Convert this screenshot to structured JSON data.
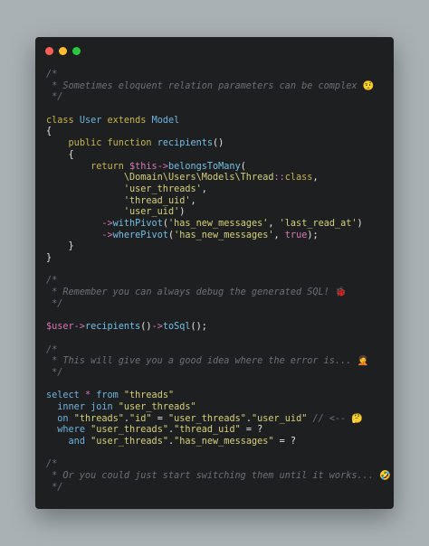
{
  "window": {
    "controls": [
      "close",
      "minimize",
      "maximize"
    ],
    "colors": {
      "close": "#ff5f57",
      "minimize": "#febc2e",
      "maximize": "#28c840"
    }
  },
  "code": {
    "lines": [
      [
        [
          "c",
          "/*"
        ]
      ],
      [
        [
          "c",
          " * Sometimes eloquent relation parameters can be complex "
        ],
        [
          "c",
          "🤨"
        ]
      ],
      [
        [
          "c",
          " */"
        ]
      ],
      [],
      [
        [
          "k",
          "class "
        ],
        [
          "t",
          "User "
        ],
        [
          "k",
          "extends "
        ],
        [
          "t",
          "Model"
        ]
      ],
      [
        [
          "p",
          "{"
        ]
      ],
      [
        [
          "p",
          "    "
        ],
        [
          "k",
          "public function "
        ],
        [
          "f",
          "recipients"
        ],
        [
          "p",
          "()"
        ]
      ],
      [
        [
          "p",
          "    {"
        ]
      ],
      [
        [
          "p",
          "        "
        ],
        [
          "k",
          "return "
        ],
        [
          "v",
          "$this"
        ],
        [
          "o",
          "->"
        ],
        [
          "f",
          "belongsToMany"
        ],
        [
          "p",
          "("
        ]
      ],
      [
        [
          "p",
          "              "
        ],
        [
          "s",
          "\\Domain\\Users\\Models\\Thread"
        ],
        [
          "o",
          "::"
        ],
        [
          "k",
          "class"
        ],
        [
          "p",
          ","
        ]
      ],
      [
        [
          "p",
          "              "
        ],
        [
          "s",
          "'user_threads'"
        ],
        [
          "p",
          ","
        ]
      ],
      [
        [
          "p",
          "              "
        ],
        [
          "s",
          "'thread_uid'"
        ],
        [
          "p",
          ","
        ]
      ],
      [
        [
          "p",
          "              "
        ],
        [
          "s",
          "'user_uid'"
        ],
        [
          "p",
          ")"
        ]
      ],
      [
        [
          "p",
          "          "
        ],
        [
          "o",
          "->"
        ],
        [
          "f",
          "withPivot"
        ],
        [
          "p",
          "("
        ],
        [
          "s",
          "'has_new_messages'"
        ],
        [
          "p",
          ", "
        ],
        [
          "s",
          "'last_read_at'"
        ],
        [
          "p",
          ")"
        ]
      ],
      [
        [
          "p",
          "          "
        ],
        [
          "o",
          "->"
        ],
        [
          "f",
          "wherePivot"
        ],
        [
          "p",
          "("
        ],
        [
          "s",
          "'has_new_messages'"
        ],
        [
          "p",
          ", "
        ],
        [
          "o",
          "true"
        ],
        [
          "p",
          ");"
        ]
      ],
      [
        [
          "p",
          "    }"
        ]
      ],
      [
        [
          "p",
          "}"
        ]
      ],
      [],
      [
        [
          "c",
          "/*"
        ]
      ],
      [
        [
          "c",
          " * Remember you can always debug the generated SQL! "
        ],
        [
          "c",
          "🐞"
        ]
      ],
      [
        [
          "c",
          " */"
        ]
      ],
      [],
      [
        [
          "v",
          "$user"
        ],
        [
          "o",
          "->"
        ],
        [
          "f",
          "recipients"
        ],
        [
          "p",
          "()"
        ],
        [
          "o",
          "->"
        ],
        [
          "f",
          "toSql"
        ],
        [
          "p",
          "();"
        ]
      ],
      [],
      [
        [
          "c",
          "/*"
        ]
      ],
      [
        [
          "c",
          " * This will give you a good idea where the error is... "
        ],
        [
          "c",
          "🤦"
        ]
      ],
      [
        [
          "c",
          " */"
        ]
      ],
      [],
      [
        [
          "t",
          "select "
        ],
        [
          "o",
          "* "
        ],
        [
          "t",
          "from "
        ],
        [
          "s",
          "\"threads\""
        ]
      ],
      [
        [
          "p",
          "  "
        ],
        [
          "t",
          "inner join "
        ],
        [
          "s",
          "\"user_threads\""
        ]
      ],
      [
        [
          "p",
          "  "
        ],
        [
          "t",
          "on "
        ],
        [
          "s",
          "\"threads\""
        ],
        [
          "p",
          "."
        ],
        [
          "s",
          "\"id\""
        ],
        [
          "p",
          " = "
        ],
        [
          "s",
          "\"user_threads\""
        ],
        [
          "p",
          "."
        ],
        [
          "s",
          "\"user_uid\""
        ],
        [
          "c",
          " // <-- "
        ],
        [
          "c",
          "🤔"
        ]
      ],
      [
        [
          "p",
          "  "
        ],
        [
          "t",
          "where "
        ],
        [
          "s",
          "\"user_threads\""
        ],
        [
          "p",
          "."
        ],
        [
          "s",
          "\"thread_uid\""
        ],
        [
          "p",
          " = ?"
        ]
      ],
      [
        [
          "p",
          "    "
        ],
        [
          "t",
          "and "
        ],
        [
          "s",
          "\"user_threads\""
        ],
        [
          "p",
          "."
        ],
        [
          "s",
          "\"has_new_messages\""
        ],
        [
          "p",
          " = ?"
        ]
      ],
      [],
      [
        [
          "c",
          "/*"
        ]
      ],
      [
        [
          "c",
          " * Or you could just start switching them until it works... "
        ],
        [
          "c",
          "🤣"
        ]
      ],
      [
        [
          "c",
          " */"
        ]
      ]
    ]
  }
}
